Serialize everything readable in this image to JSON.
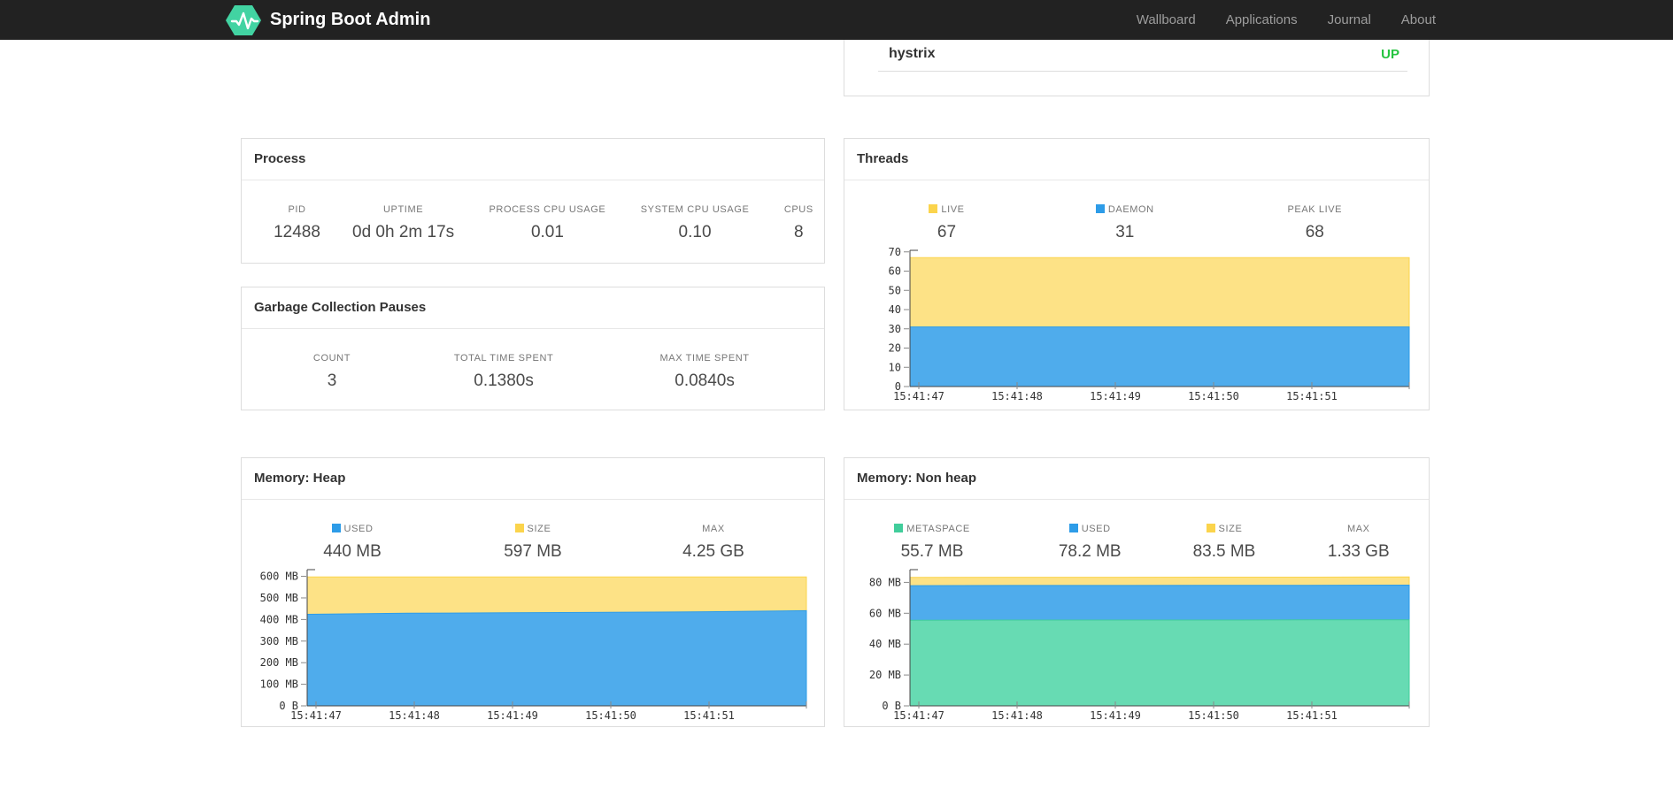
{
  "navbar": {
    "brand": "Spring Boot Admin",
    "items": [
      {
        "label": "Wallboard"
      },
      {
        "label": "Applications"
      },
      {
        "label": "Journal"
      },
      {
        "label": "About"
      }
    ]
  },
  "applications_panel": {
    "rows": [
      {
        "name": "hystrix",
        "status": "UP"
      }
    ]
  },
  "colors": {
    "yellow": {
      "solid": "#fbd44c",
      "fill": "#fde286"
    },
    "blue": {
      "solid": "#2d9ce8",
      "fill": "#4facec"
    },
    "green": {
      "solid": "#41cd9b",
      "fill": "#67dbb3"
    },
    "up_status": "#24c43f",
    "navbar_bg": "#222222",
    "nav_link": "#9d9d9d",
    "card_border": "#dddddd",
    "logo": "#42d3a2",
    "axis": "#444444",
    "tick": "#888888"
  },
  "cards": {
    "process": {
      "title": "Process",
      "stats": [
        {
          "label": "PID",
          "value": "12488"
        },
        {
          "label": "UPTIME",
          "value": "0d 0h 2m 17s"
        },
        {
          "label": "PROCESS CPU USAGE",
          "value": "0.01"
        },
        {
          "label": "SYSTEM CPU USAGE",
          "value": "0.10"
        },
        {
          "label": "CPUS",
          "value": "8"
        }
      ]
    },
    "gc": {
      "title": "Garbage Collection Pauses",
      "stats": [
        {
          "label": "COUNT",
          "value": "3"
        },
        {
          "label": "TOTAL TIME SPENT",
          "value": "0.1380s"
        },
        {
          "label": "MAX TIME SPENT",
          "value": "0.0840s"
        }
      ]
    },
    "threads": {
      "title": "Threads",
      "stats": [
        {
          "label": "LIVE",
          "value": "67",
          "legend": "yellow"
        },
        {
          "label": "DAEMON",
          "value": "31",
          "legend": "blue"
        },
        {
          "label": "PEAK LIVE",
          "value": "68"
        }
      ]
    },
    "heap": {
      "title": "Memory: Heap",
      "stats": [
        {
          "label": "USED",
          "value": "440 MB",
          "legend": "blue"
        },
        {
          "label": "SIZE",
          "value": "597 MB",
          "legend": "yellow"
        },
        {
          "label": "MAX",
          "value": "4.25 GB"
        }
      ]
    },
    "nonheap": {
      "title": "Memory: Non heap",
      "stats": [
        {
          "label": "METASPACE",
          "value": "55.7 MB",
          "legend": "green"
        },
        {
          "label": "USED",
          "value": "78.2 MB",
          "legend": "blue"
        },
        {
          "label": "SIZE",
          "value": "83.5 MB",
          "legend": "yellow"
        },
        {
          "label": "MAX",
          "value": "1.33 GB"
        }
      ]
    }
  },
  "chart_data": [
    {
      "id": "threads-chart",
      "type": "area",
      "title": "Threads",
      "x": [
        "15:41:47",
        "15:41:48",
        "15:41:49",
        "15:41:50",
        "15:41:51"
      ],
      "series": [
        {
          "name": "LIVE",
          "color": "yellow",
          "values": [
            67,
            67,
            67,
            67,
            67,
            67
          ]
        },
        {
          "name": "DAEMON",
          "color": "blue",
          "values": [
            31,
            31,
            31,
            31,
            31,
            31
          ]
        }
      ],
      "ylim": [
        0,
        70.35
      ],
      "yticks": [
        {
          "v": 0,
          "label": "0"
        },
        {
          "v": 10,
          "label": "10"
        },
        {
          "v": 20,
          "label": "20"
        },
        {
          "v": 30,
          "label": "30"
        },
        {
          "v": 40,
          "label": "40"
        },
        {
          "v": 50,
          "label": "50"
        },
        {
          "v": 60,
          "label": "60"
        },
        {
          "v": 70,
          "label": "70"
        }
      ],
      "grid": false,
      "legend_position": "stats-row-above"
    },
    {
      "id": "heap-chart",
      "type": "area",
      "title": "Memory: Heap",
      "x": [
        "15:41:47",
        "15:41:48",
        "15:41:49",
        "15:41:50",
        "15:41:51"
      ],
      "series": [
        {
          "name": "SIZE",
          "color": "yellow",
          "values": [
            597,
            597,
            597,
            597,
            597,
            597
          ]
        },
        {
          "name": "USED",
          "color": "blue",
          "values": [
            424,
            429,
            431,
            433,
            436,
            441
          ]
        }
      ],
      "ylim": [
        0,
        626.85
      ],
      "yticks": [
        {
          "v": 0,
          "label": "0 B"
        },
        {
          "v": 100,
          "label": "100 MB"
        },
        {
          "v": 200,
          "label": "200 MB"
        },
        {
          "v": 300,
          "label": "300 MB"
        },
        {
          "v": 400,
          "label": "400 MB"
        },
        {
          "v": 500,
          "label": "500 MB"
        },
        {
          "v": 600,
          "label": "600 MB"
        }
      ],
      "grid": false,
      "legend_position": "stats-row-above"
    },
    {
      "id": "nonheap-chart",
      "type": "area",
      "title": "Memory: Non heap",
      "x": [
        "15:41:47",
        "15:41:48",
        "15:41:49",
        "15:41:50",
        "15:41:51"
      ],
      "series": [
        {
          "name": "SIZE",
          "color": "yellow",
          "values": [
            83.2,
            83.3,
            83.3,
            83.4,
            83.4,
            83.5
          ]
        },
        {
          "name": "USED",
          "color": "blue",
          "values": [
            77.9,
            78.0,
            78.0,
            78.1,
            78.1,
            78.2
          ]
        },
        {
          "name": "METASPACE",
          "color": "green",
          "values": [
            55.5,
            55.6,
            55.6,
            55.6,
            55.7,
            55.7
          ]
        }
      ],
      "ylim": [
        0,
        87.68
      ],
      "yticks": [
        {
          "v": 0,
          "label": "0 B"
        },
        {
          "v": 20,
          "label": "20 MB"
        },
        {
          "v": 40,
          "label": "40 MB"
        },
        {
          "v": 60,
          "label": "60 MB"
        },
        {
          "v": 80,
          "label": "80 MB"
        }
      ],
      "grid": false,
      "legend_position": "stats-row-above"
    }
  ]
}
